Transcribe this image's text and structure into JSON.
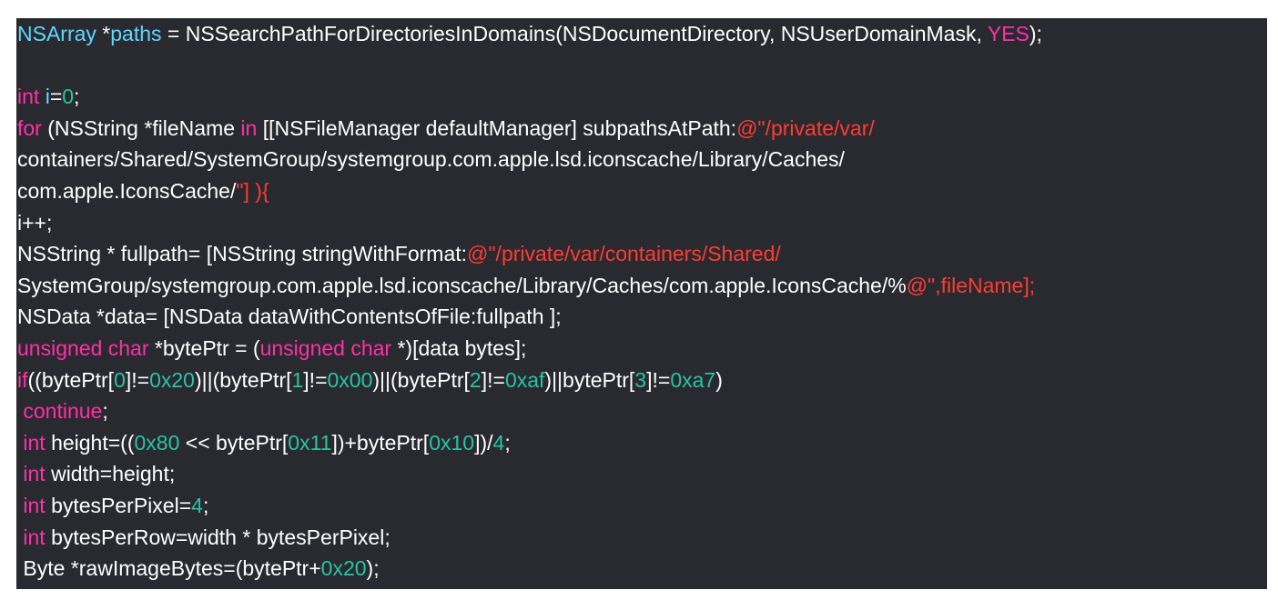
{
  "colors": {
    "background": "#292a30",
    "page": "#ffffff",
    "plain": "#ffffff",
    "type": "#5dd8ff",
    "keyword": "#ff2fa6",
    "string": "#ff3b30",
    "number": "#27c4a6"
  },
  "code": {
    "lines": [
      [
        {
          "t": "type",
          "v": "NSArray"
        },
        {
          "t": "plain",
          "v": " *"
        },
        {
          "t": "type",
          "v": "paths"
        },
        {
          "t": "plain",
          "v": " = NSSearchPathForDirectoriesInDomains(NSDocumentDirectory, NSUserDomainMask, "
        },
        {
          "t": "keyword",
          "v": "YES"
        },
        {
          "t": "plain",
          "v": ");"
        }
      ],
      [],
      [
        {
          "t": "keyword",
          "v": "int"
        },
        {
          "t": "plain",
          "v": " "
        },
        {
          "t": "type",
          "v": "i"
        },
        {
          "t": "plain",
          "v": "="
        },
        {
          "t": "number",
          "v": "0"
        },
        {
          "t": "plain",
          "v": ";"
        }
      ],
      [
        {
          "t": "keyword",
          "v": "for"
        },
        {
          "t": "plain",
          "v": " (NSString *fileName "
        },
        {
          "t": "keyword",
          "v": "in"
        },
        {
          "t": "plain",
          "v": " [[NSFileManager defaultManager] subpathsAtPath:"
        },
        {
          "t": "string",
          "v": "@\"/private/var/"
        }
      ],
      [
        {
          "t": "plain",
          "v": "containers/Shared/SystemGroup/systemgroup.com.apple.lsd.iconscache/Library/Caches/"
        }
      ],
      [
        {
          "t": "plain",
          "v": "com.apple.IconsCache/"
        },
        {
          "t": "string",
          "v": "\"] ){"
        }
      ],
      [
        {
          "t": "plain",
          "v": "i++;"
        }
      ],
      [
        {
          "t": "plain",
          "v": "NSString * fullpath= [NSString stringWithFormat:"
        },
        {
          "t": "string",
          "v": "@\"/private/var/containers/Shared/"
        }
      ],
      [
        {
          "t": "plain",
          "v": "SystemGroup/systemgroup.com.apple.lsd.iconscache/Library/Caches/com.apple.IconsCache/%"
        },
        {
          "t": "string",
          "v": "@\",fileName];"
        }
      ],
      [
        {
          "t": "plain",
          "v": "NSData *data= [NSData dataWithContentsOfFile:fullpath ];"
        }
      ],
      [
        {
          "t": "keyword",
          "v": "unsigned"
        },
        {
          "t": "plain",
          "v": " "
        },
        {
          "t": "keyword",
          "v": "char"
        },
        {
          "t": "plain",
          "v": " *bytePtr = ("
        },
        {
          "t": "keyword",
          "v": "unsigned"
        },
        {
          "t": "plain",
          "v": " "
        },
        {
          "t": "keyword",
          "v": "char"
        },
        {
          "t": "plain",
          "v": " *)[data bytes];"
        }
      ],
      [
        {
          "t": "keyword",
          "v": "if"
        },
        {
          "t": "plain",
          "v": "((bytePtr["
        },
        {
          "t": "number",
          "v": "0"
        },
        {
          "t": "plain",
          "v": "]!="
        },
        {
          "t": "number",
          "v": "0x20"
        },
        {
          "t": "plain",
          "v": ")||(bytePtr["
        },
        {
          "t": "number",
          "v": "1"
        },
        {
          "t": "plain",
          "v": "]!="
        },
        {
          "t": "number",
          "v": "0x00"
        },
        {
          "t": "plain",
          "v": ")||(bytePtr["
        },
        {
          "t": "number",
          "v": "2"
        },
        {
          "t": "plain",
          "v": "]!="
        },
        {
          "t": "number",
          "v": "0xaf"
        },
        {
          "t": "plain",
          "v": ")||bytePtr["
        },
        {
          "t": "number",
          "v": "3"
        },
        {
          "t": "plain",
          "v": "]!="
        },
        {
          "t": "number",
          "v": "0xa7"
        },
        {
          "t": "plain",
          "v": ")"
        }
      ],
      [
        {
          "t": "plain",
          "v": " "
        },
        {
          "t": "keyword",
          "v": "continue"
        },
        {
          "t": "plain",
          "v": ";"
        }
      ],
      [
        {
          "t": "plain",
          "v": " "
        },
        {
          "t": "keyword",
          "v": "int"
        },
        {
          "t": "plain",
          "v": " height=(("
        },
        {
          "t": "number",
          "v": "0x80"
        },
        {
          "t": "plain",
          "v": " << bytePtr["
        },
        {
          "t": "number",
          "v": "0x11"
        },
        {
          "t": "plain",
          "v": "])+bytePtr["
        },
        {
          "t": "number",
          "v": "0x10"
        },
        {
          "t": "plain",
          "v": "])/"
        },
        {
          "t": "number",
          "v": "4"
        },
        {
          "t": "plain",
          "v": ";"
        }
      ],
      [
        {
          "t": "plain",
          "v": " "
        },
        {
          "t": "keyword",
          "v": "int"
        },
        {
          "t": "plain",
          "v": " width=height;"
        }
      ],
      [
        {
          "t": "plain",
          "v": " "
        },
        {
          "t": "keyword",
          "v": "int"
        },
        {
          "t": "plain",
          "v": " bytesPerPixel="
        },
        {
          "t": "number",
          "v": "4"
        },
        {
          "t": "plain",
          "v": ";"
        }
      ],
      [
        {
          "t": "plain",
          "v": " "
        },
        {
          "t": "keyword",
          "v": "int"
        },
        {
          "t": "plain",
          "v": " bytesPerRow=width * bytesPerPixel;"
        }
      ],
      [
        {
          "t": "plain",
          "v": " Byte *rawImageBytes=(bytePtr+"
        },
        {
          "t": "number",
          "v": "0x20"
        },
        {
          "t": "plain",
          "v": ");"
        }
      ]
    ]
  }
}
